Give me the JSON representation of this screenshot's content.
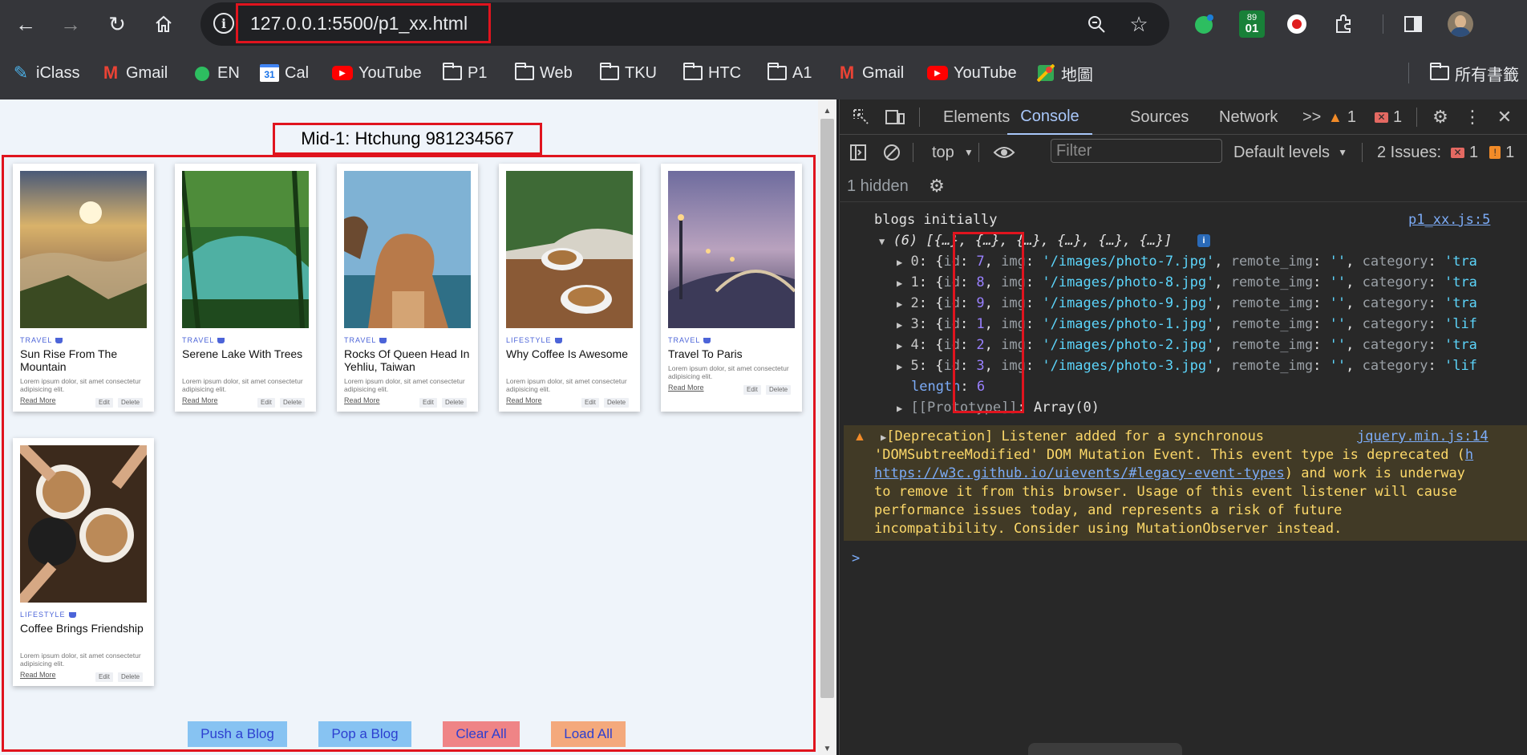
{
  "browser": {
    "url": "127.0.0.1:5500/p1_xx.html",
    "bookmarks": [
      {
        "label": "iClass",
        "icon": "iclass-icon"
      },
      {
        "label": "Gmail",
        "icon": "gmail-icon"
      },
      {
        "label": "EN",
        "icon": "evernote-icon"
      },
      {
        "label": "Cal",
        "icon": "calendar-icon"
      },
      {
        "label": "YouTube",
        "icon": "youtube-icon"
      },
      {
        "label": "P1",
        "icon": "folder-icon"
      },
      {
        "label": "Web",
        "icon": "folder-icon"
      },
      {
        "label": "TKU",
        "icon": "folder-icon"
      },
      {
        "label": "HTC",
        "icon": "folder-icon"
      },
      {
        "label": "A1",
        "icon": "folder-icon"
      },
      {
        "label": "Gmail",
        "icon": "gmail-icon"
      },
      {
        "label": "YouTube",
        "icon": "youtube-icon"
      },
      {
        "label": "地圖",
        "icon": "maps-icon"
      }
    ],
    "all_bookmarks": "所有書籤",
    "calendar_day": "31",
    "ext_badge_top": "89",
    "ext_badge_bottom": "01"
  },
  "page": {
    "title": "Mid-1: Htchung 981234567",
    "blogs": [
      {
        "category": "TRAVEL",
        "title": "Sun Rise From The Mountain",
        "desc": "Lorem ipsum dolor, sit amet consectetur adipisicing elit.",
        "read_more": "Read More",
        "edit": "Edit",
        "delete": "Delete"
      },
      {
        "category": "TRAVEL",
        "title": "Serene Lake With Trees",
        "desc": "Lorem ipsum dolor, sit amet consectetur adipisicing elit.",
        "read_more": "Read More",
        "edit": "Edit",
        "delete": "Delete"
      },
      {
        "category": "TRAVEL",
        "title": "Rocks Of Queen Head In Yehliu, Taiwan",
        "desc": "Lorem ipsum dolor, sit amet consectetur adipisicing elit.",
        "read_more": "Read More",
        "edit": "Edit",
        "delete": "Delete"
      },
      {
        "category": "LIFESTYLE",
        "title": "Why Coffee Is Awesome",
        "desc": "Lorem ipsum dolor, sit amet consectetur adipisicing elit.",
        "read_more": "Read More",
        "edit": "Edit",
        "delete": "Delete"
      },
      {
        "category": "TRAVEL",
        "title": "Travel To Paris",
        "desc": "Lorem ipsum dolor, sit amet consectetur adipisicing elit.",
        "read_more": "Read More",
        "edit": "Edit",
        "delete": "Delete"
      },
      {
        "category": "LIFESTYLE",
        "title": "Coffee Brings Friendship",
        "desc": "Lorem ipsum dolor, sit amet consectetur adipisicing elit.",
        "read_more": "Read More",
        "edit": "Edit",
        "delete": "Delete"
      }
    ],
    "buttons": {
      "push": "Push a Blog",
      "pop": "Pop a Blog",
      "clear": "Clear All",
      "load": "Load All"
    },
    "button_colors": {
      "push": "#87c3f2",
      "pop": "#87c3f2",
      "clear": "#ef8486",
      "load": "#f4a97c"
    }
  },
  "devtools": {
    "tabs": [
      "Elements",
      "Console",
      "Sources",
      "Network"
    ],
    "active_tab": "Console",
    "more": ">>",
    "warn_count": "1",
    "error_count": "1",
    "context": "top",
    "filter_placeholder": "Filter",
    "levels": "Default levels",
    "issues_label": "2 Issues:",
    "issues_err": "1",
    "issues_warn": "1",
    "hidden": "1 hidden",
    "console": {
      "log_label": "blogs initially",
      "log_source": "p1_xx.js:5",
      "array_summary": "(6) [{…}, {…}, {…}, {…}, {…}, {…}]",
      "info_badge": "i",
      "rows": [
        {
          "idx": "0",
          "id": "7",
          "img": "'/images/photo-7.jpg'",
          "cat": "'tra"
        },
        {
          "idx": "1",
          "id": "8",
          "img": "'/images/photo-8.jpg'",
          "cat": "'tra"
        },
        {
          "idx": "2",
          "id": "9",
          "img": "'/images/photo-9.jpg'",
          "cat": "'tra"
        },
        {
          "idx": "3",
          "id": "1",
          "img": "'/images/photo-1.jpg'",
          "cat": "'lif"
        },
        {
          "idx": "4",
          "id": "2",
          "img": "'/images/photo-2.jpg'",
          "cat": "'tra"
        },
        {
          "idx": "5",
          "id": "3",
          "img": "'/images/photo-3.jpg'",
          "cat": "'lif"
        }
      ],
      "length_label": "length",
      "length_value": "6",
      "prototype": "[[Prototype]]",
      "prototype_value": "Array(0)",
      "warning": {
        "line1": "[Deprecation] Listener added for a synchronous",
        "source": "jquery.min.js:14",
        "line2a": "'DOMSubtreeModified' DOM Mutation Event. This event type is deprecated (",
        "line2b": "h",
        "line3a": "https://w3c.github.io/uievents/#legacy-event-types",
        "line3b": ") and work is underway",
        "line4": "to remove it from this browser. Usage of this event listener will cause",
        "line5": "performance issues today, and represents a risk of future",
        "line6": "incompatibility. Consider using MutationObserver instead."
      },
      "prompt": ">"
    }
  }
}
